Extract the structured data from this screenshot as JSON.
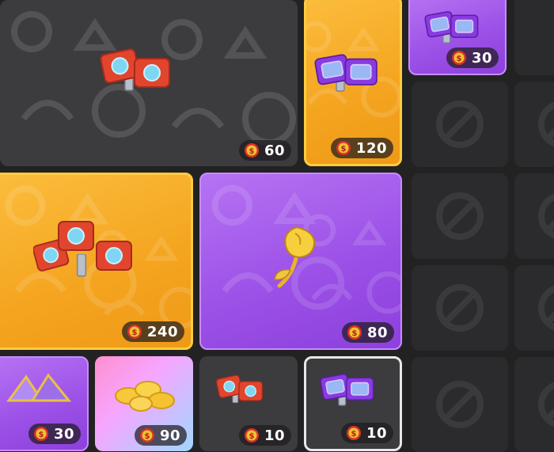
{
  "tiles": [
    {
      "id": "big-gray",
      "item": "red-cards-pair-icon",
      "price": "60"
    },
    {
      "id": "gold-small",
      "item": "purple-cards-icon",
      "price": "120"
    },
    {
      "id": "purple-tiny",
      "item": "purple-cards-icon",
      "price": "30"
    },
    {
      "id": "big-gold",
      "item": "red-cards-stack-icon",
      "price": "240"
    },
    {
      "id": "big-purple",
      "item": "golden-rose-icon",
      "price": "80"
    },
    {
      "id": "purple-bottom",
      "item": "gem-pile-icon",
      "price": "30"
    },
    {
      "id": "pink-bottom",
      "item": "candy-pile-icon",
      "price": "90"
    },
    {
      "id": "gray-bottom",
      "item": "red-cards-pair-icon",
      "price": "10"
    },
    {
      "id": "selected-bottom",
      "item": "purple-cards-icon",
      "price": "10"
    }
  ],
  "colors": {
    "gold": "#f4a41f",
    "purple": "#9a4fe6",
    "gray": "#3c3b3e",
    "background": "#232223",
    "coin": "#d9302a"
  }
}
